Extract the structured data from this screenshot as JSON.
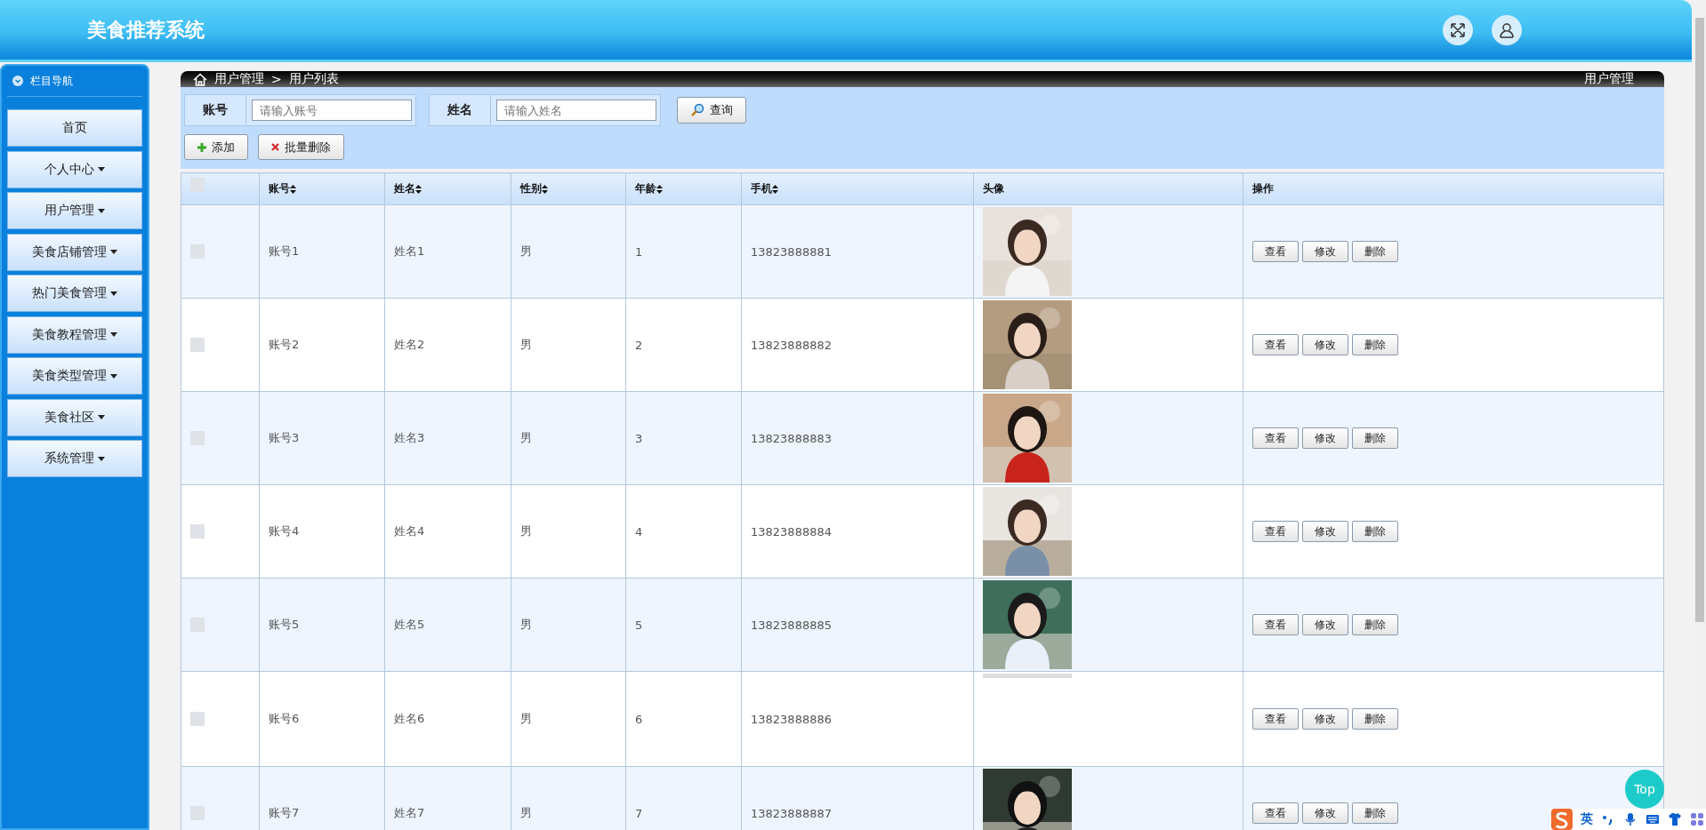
{
  "header": {
    "title": "美食推荐系统"
  },
  "sidebar": {
    "title": "栏目导航",
    "items": [
      {
        "label": "首页",
        "dropdown": false
      },
      {
        "label": "个人中心",
        "dropdown": true
      },
      {
        "label": "用户管理",
        "dropdown": true
      },
      {
        "label": "美食店铺管理",
        "dropdown": true
      },
      {
        "label": "热门美食管理",
        "dropdown": true
      },
      {
        "label": "美食教程管理",
        "dropdown": true
      },
      {
        "label": "美食类型管理",
        "dropdown": true
      },
      {
        "label": "美食社区",
        "dropdown": true
      },
      {
        "label": "系统管理",
        "dropdown": true
      }
    ]
  },
  "breadcrumb": {
    "items": [
      "用户管理",
      "用户列表"
    ],
    "separator": ">",
    "page_title": "用户管理"
  },
  "search": {
    "fields": [
      {
        "label": "账号",
        "placeholder": "请输入账号"
      },
      {
        "label": "姓名",
        "placeholder": "请输入姓名"
      }
    ],
    "button": "查询"
  },
  "actions": [
    {
      "kind": "add",
      "label": "添加"
    },
    {
      "kind": "delete",
      "label": "批量删除"
    }
  ],
  "table": {
    "header_checked": false,
    "columns": [
      {
        "label": "账号",
        "sortable": true
      },
      {
        "label": "姓名",
        "sortable": true
      },
      {
        "label": "性别",
        "sortable": true
      },
      {
        "label": "年龄",
        "sortable": true
      },
      {
        "label": "手机",
        "sortable": true
      },
      {
        "label": "头像",
        "sortable": false
      },
      {
        "label": "操作",
        "sortable": false
      }
    ],
    "rows": [
      {
        "checked": false,
        "account": "账号1",
        "name": "姓名1",
        "gender": "男",
        "age": "1",
        "phone": "13823888881",
        "avatar": {
          "kind": "picture"
        },
        "actions": [
          "查看",
          "修改",
          "删除"
        ]
      },
      {
        "checked": false,
        "account": "账号2",
        "name": "姓名2",
        "gender": "男",
        "age": "2",
        "phone": "13823888882",
        "avatar": {
          "kind": "picture"
        },
        "actions": [
          "查看",
          "修改",
          "删除"
        ]
      },
      {
        "checked": false,
        "account": "账号3",
        "name": "姓名3",
        "gender": "男",
        "age": "3",
        "phone": "13823888883",
        "avatar": {
          "kind": "picture"
        },
        "actions": [
          "查看",
          "修改",
          "删除"
        ]
      },
      {
        "checked": false,
        "account": "账号4",
        "name": "姓名4",
        "gender": "男",
        "age": "4",
        "phone": "13823888884",
        "avatar": {
          "kind": "picture"
        },
        "actions": [
          "查看",
          "修改",
          "删除"
        ]
      },
      {
        "checked": false,
        "account": "账号5",
        "name": "姓名5",
        "gender": "男",
        "age": "5",
        "phone": "13823888885",
        "avatar": {
          "kind": "picture"
        },
        "actions": [
          "查看",
          "修改",
          "删除"
        ]
      },
      {
        "checked": false,
        "account": "账号6",
        "name": "姓名6",
        "gender": "男",
        "age": "6",
        "phone": "13823888886",
        "avatar": {
          "kind": "picture",
          "cut": true
        },
        "actions": [
          "查看",
          "修改",
          "删除"
        ]
      },
      {
        "checked": false,
        "account": "账号7",
        "name": "姓名7",
        "gender": "男",
        "age": "7",
        "phone": "13823888887",
        "avatar": {
          "kind": "picture"
        },
        "actions": [
          "查看",
          "修改",
          "删除"
        ]
      }
    ]
  },
  "top_button": "Top",
  "ime": {
    "label": "英"
  }
}
